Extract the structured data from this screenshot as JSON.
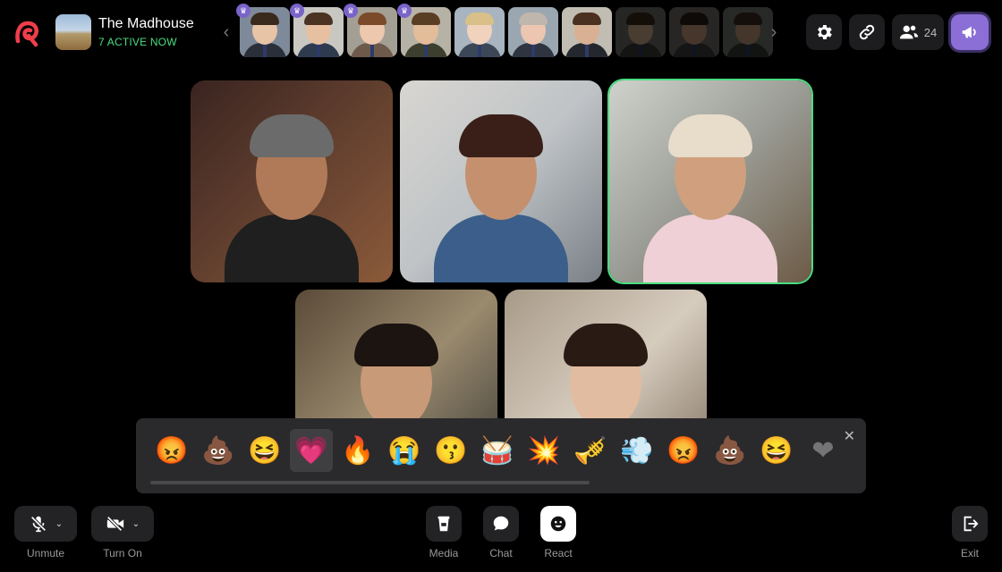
{
  "room": {
    "title": "The Madhouse",
    "active": "7 ACTIVE NOW"
  },
  "header": {
    "participant_count": "24"
  },
  "strip": {
    "faces": [
      {
        "crowned": true,
        "skin": "#e8c4a6",
        "hair": "#3a2a1e",
        "bg": "#7e8a9a",
        "suit": "#2a2f3a",
        "dim": false
      },
      {
        "crowned": true,
        "skin": "#e6c0a0",
        "hair": "#4a3322",
        "bg": "#c9c7c2",
        "suit": "#2e3a4e",
        "dim": false
      },
      {
        "crowned": true,
        "skin": "#eec8ae",
        "hair": "#7a4a2a",
        "bg": "#a49f94",
        "suit": "#6d5a4a",
        "dim": false
      },
      {
        "crowned": true,
        "skin": "#e3bc9a",
        "hair": "#5a3e24",
        "bg": "#b7b2a6",
        "suit": "#3c3f2e",
        "dim": false
      },
      {
        "crowned": false,
        "skin": "#f1d2bc",
        "hair": "#d9c089",
        "bg": "#a8b4bf",
        "suit": "#3b4757",
        "dim": false
      },
      {
        "crowned": false,
        "skin": "#ecc6b0",
        "hair": "#bfb6ad",
        "bg": "#9aa6b0",
        "suit": "#2e3440",
        "dim": false
      },
      {
        "crowned": false,
        "skin": "#d9b094",
        "hair": "#4a3020",
        "bg": "#c2bdb3",
        "suit": "#24282e",
        "dim": false
      },
      {
        "crowned": false,
        "skin": "#d2ac8e",
        "hair": "#3a2a1c",
        "bg": "#6d6f69",
        "suit": "#3a3a36",
        "dim": true
      },
      {
        "crowned": false,
        "skin": "#c89c7e",
        "hair": "#2a1e16",
        "bg": "#6f6e6a",
        "suit": "#3b3c3a",
        "dim": true
      },
      {
        "crowned": false,
        "skin": "#c49a7c",
        "hair": "#3b2b20",
        "bg": "#70776f",
        "suit": "#343a34",
        "dim": true
      }
    ]
  },
  "tiles": [
    {
      "bg": "linear-gradient(135deg,#3a2420 0%,#5a3a2c 40%,#8b5a3a 100%)",
      "skin": "#b07a58",
      "hair": "#6b6b6b",
      "shirt": "#1f1f1f",
      "active": false
    },
    {
      "bg": "linear-gradient(135deg,#d8d6d2 0%,#bfc3c6 50%,#7a8087 100%)",
      "skin": "#c4906e",
      "hair": "#3a1f18",
      "shirt": "#3b5f8a",
      "active": false
    },
    {
      "bg": "linear-gradient(135deg,#cfd2cc 0%,#9a9c95 50%,#6d5a46 100%)",
      "skin": "#d0a07e",
      "hair": "#e8dccb",
      "shirt": "#efd0d6",
      "active": true
    },
    {
      "bg": "linear-gradient(135deg,#5a4a38 0%,#9a8a6e 50%,#3a3a36 100%)",
      "skin": "#c89a78",
      "hair": "#1c1410",
      "shirt": "#2e4c72",
      "active": false
    },
    {
      "bg": "linear-gradient(135deg,#a89a88 0%,#d6ccbe 50%,#7c6c5c 100%)",
      "skin": "#e2bca0",
      "hair": "#2a1a14",
      "shirt": "#1a1a1a",
      "active": false
    }
  ],
  "reactions": {
    "emojis": [
      {
        "glyph": "😡",
        "name": "angry-emoji"
      },
      {
        "glyph": "💩",
        "name": "poop-emoji"
      },
      {
        "glyph": "😆",
        "name": "laughing-emoji"
      },
      {
        "glyph": "💗",
        "name": "heart-emoji"
      },
      {
        "glyph": "🔥",
        "name": "fire-emoji"
      },
      {
        "glyph": "😭",
        "name": "crying-emoji"
      },
      {
        "glyph": "😗",
        "name": "whistling-emoji"
      },
      {
        "glyph": "🥁",
        "name": "drum-emoji"
      },
      {
        "glyph": "💥",
        "name": "explosion-emoji"
      },
      {
        "glyph": "🎺",
        "name": "trumpet-emoji"
      },
      {
        "glyph": "💨",
        "name": "fart-cloud-emoji"
      },
      {
        "glyph": "😡",
        "name": "angry-emoji"
      },
      {
        "glyph": "💩",
        "name": "poop-emoji"
      },
      {
        "glyph": "😆",
        "name": "laughing-emoji"
      },
      {
        "glyph": "❤",
        "name": "heart-emoji"
      }
    ],
    "selected_index": 3,
    "close": "✕"
  },
  "controls": {
    "unmute": "Unmute",
    "turn_on": "Turn On",
    "media": "Media",
    "chat": "Chat",
    "react": "React",
    "exit": "Exit"
  },
  "colors": {
    "accent": "#8b6fd6",
    "active": "#4ade80",
    "brand": "#ef3e4a"
  }
}
